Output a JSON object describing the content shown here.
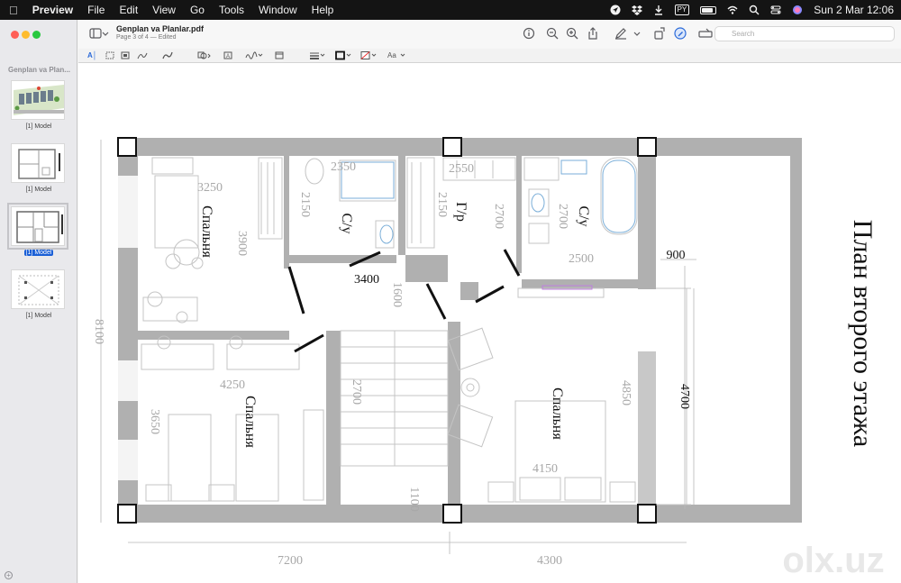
{
  "menubar": {
    "apple": "",
    "app": "Preview",
    "items": [
      "File",
      "Edit",
      "View",
      "Go",
      "Tools",
      "Window",
      "Help"
    ],
    "input_badge": "PY",
    "clock": "Sun 2 Mar  12:06"
  },
  "sidebar": {
    "doc_label": "Genplan va Plan...",
    "thumbnails": [
      {
        "label": "[1] Model"
      },
      {
        "label": "[1] Model"
      },
      {
        "label": "[1] Model"
      },
      {
        "label": "[1] Model"
      }
    ]
  },
  "toolbar": {
    "title": "Genplan va Planlar.pdf",
    "subtitle": "Page 3 of 4 — Edited",
    "search_placeholder": "Search"
  },
  "markup": {
    "text_style": "Aa"
  },
  "plan": {
    "title": "План второго этажа",
    "rooms": {
      "bedroom_1": "Спальня",
      "bedroom_2": "Спальня",
      "bedroom_3": "Спальня",
      "bath_1": "С/у",
      "bath_2": "С/у",
      "dressing": "Г/р"
    },
    "dims": {
      "d3250": "3250",
      "d3900": "3900",
      "d2350": "2350",
      "d2150a": "2150",
      "d2550": "2550",
      "d2150b": "2150",
      "d2700a": "2700",
      "d2700b": "2700",
      "d2500": "2500",
      "d900": "900",
      "d3400": "3400",
      "d1600": "1600",
      "d8100": "8100",
      "d4250": "4250",
      "d3650": "3650",
      "d2700c": "2700",
      "d4850": "4850",
      "d4700": "4700",
      "d4150": "4150",
      "d1100": "1100",
      "d7200": "7200",
      "d4300": "4300"
    },
    "watermark": "olx.uz"
  }
}
